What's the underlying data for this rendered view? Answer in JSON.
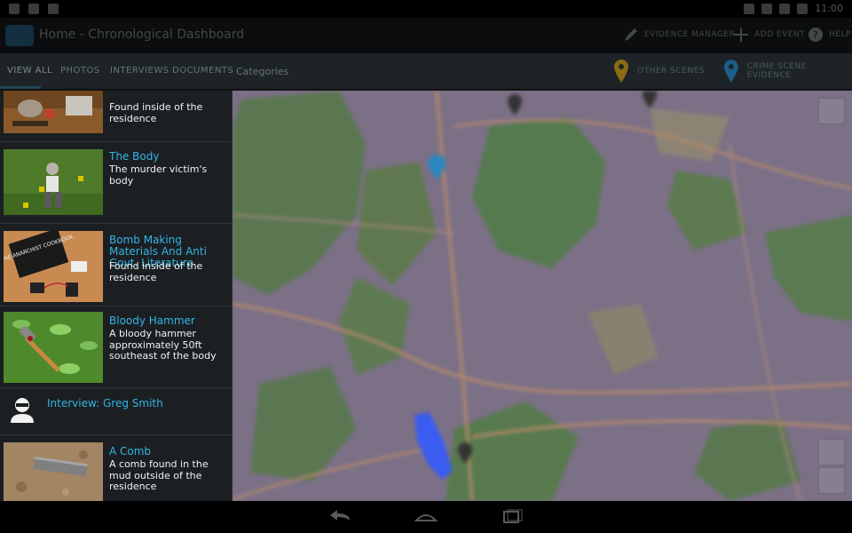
{
  "status_bar": {
    "time": "11:00"
  },
  "action_bar": {
    "title": "Home - Chronological Dashboard",
    "actions": [
      {
        "label": "EVIDENCE MANAGER",
        "icon": "pencil-icon"
      },
      {
        "label": "ADD EVENT",
        "icon": "plus-icon"
      },
      {
        "label": "HELP",
        "icon": "help-icon"
      }
    ]
  },
  "tabs": {
    "items": [
      "VIEW ALL",
      "PHOTOS",
      "INTERVIEWS",
      "DOCUMENTS",
      "Categories"
    ],
    "poi_buttons": [
      {
        "label": "OTHER SCENES",
        "color": "#c79a1c",
        "icon": "map-pin-icon"
      },
      {
        "label": "CRIME SCENE EVIDENCE",
        "color": "#2a86c0",
        "icon": "map-pin-icon"
      }
    ]
  },
  "evidence_list": [
    {
      "title": "",
      "description": "Found inside of the residence",
      "thumb": "items-on-table"
    },
    {
      "title": "The Body",
      "description": "The murder victim's body",
      "thumb": "body-on-grass"
    },
    {
      "title": "Bomb Making Materials And Anti Govt. Literature",
      "description": "Found inside of the residence",
      "thumb": "anarchist-cookbook"
    },
    {
      "title": "Bloody Hammer",
      "description": "A bloody hammer approximately 50ft southeast of the body",
      "thumb": "hammer-on-grass"
    },
    {
      "title": "Interview: Greg Smith",
      "description": "",
      "thumb": "person-icon"
    },
    {
      "title": "A Comb",
      "description": "A comb found in the mud outside of the residence",
      "thumb": "comb-in-mud"
    }
  ],
  "thumb_text": {
    "cookbook": "THE ANARCHIST COOKBOOK"
  },
  "colors": {
    "accent": "#33b5e5",
    "panel_bg": "#1b1f22",
    "map_base": "#7a6f85",
    "forest": "#5a7a52",
    "lake": "#3b5cf0"
  }
}
